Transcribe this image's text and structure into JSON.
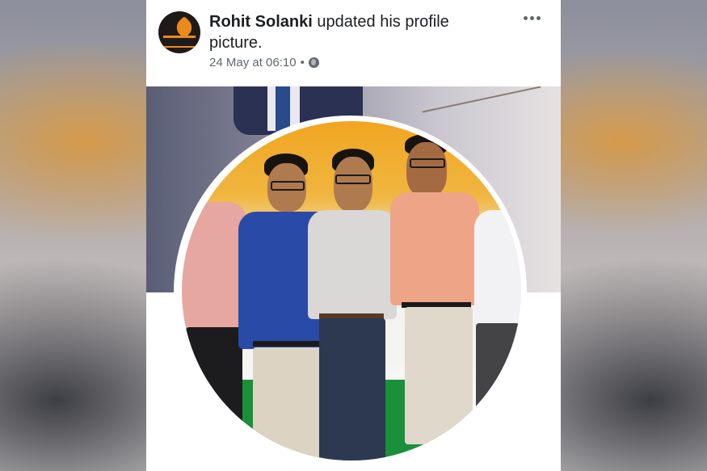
{
  "post": {
    "author": "Rohit Solanki",
    "action": " updated his profile picture.",
    "timestamp": "24 May at 06:10",
    "separator": "•"
  },
  "icons": {
    "avatar": "page-avatar",
    "more": "more-options-icon",
    "privacy": "globe-icon"
  },
  "colors": {
    "name_text": "#1c1e21",
    "meta_text": "#606770",
    "card_bg": "#ffffff"
  }
}
